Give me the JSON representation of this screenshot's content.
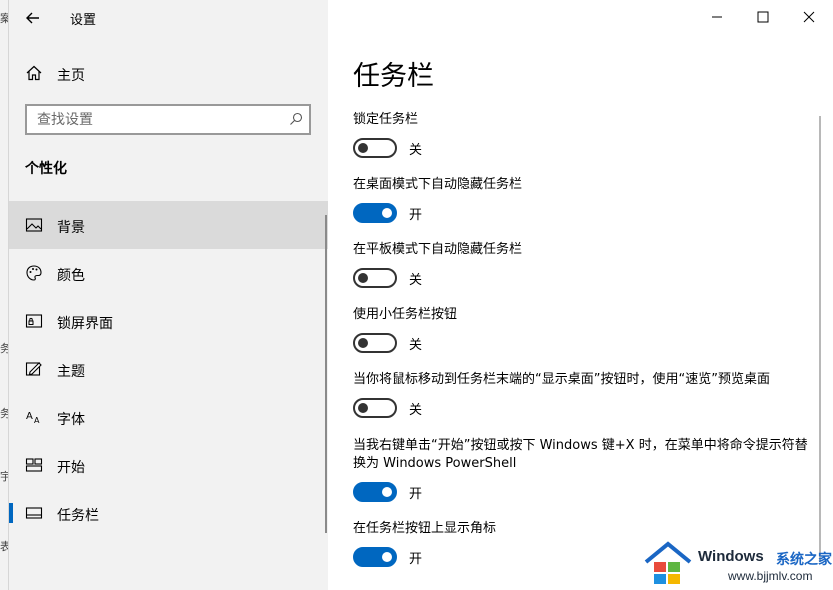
{
  "background_edge": {
    "fragments": [
      "案",
      "务",
      "务",
      "宇",
      "表"
    ]
  },
  "window": {
    "title": "设置"
  },
  "sidebar": {
    "home_label": "主页",
    "search_placeholder": "查找设置",
    "section_title": "个性化",
    "items": [
      {
        "label": "背景",
        "icon": "image-icon",
        "state": "hover"
      },
      {
        "label": "颜色",
        "icon": "palette-icon"
      },
      {
        "label": "锁屏界面",
        "icon": "lock-screen-icon"
      },
      {
        "label": "主题",
        "icon": "theme-icon"
      },
      {
        "label": "字体",
        "icon": "font-icon"
      },
      {
        "label": "开始",
        "icon": "start-icon"
      },
      {
        "label": "任务栏",
        "icon": "taskbar-icon",
        "state": "selected"
      }
    ]
  },
  "main": {
    "title": "任务栏",
    "settings": [
      {
        "desc": "锁定任务栏",
        "on": false,
        "state_label": "关"
      },
      {
        "desc": "在桌面模式下自动隐藏任务栏",
        "on": true,
        "state_label": "开"
      },
      {
        "desc": "在平板模式下自动隐藏任务栏",
        "on": false,
        "state_label": "关"
      },
      {
        "desc": "使用小任务栏按钮",
        "on": false,
        "state_label": "关"
      },
      {
        "desc": "当你将鼠标移动到任务栏末端的“显示桌面”按钮时，使用“速览”预览桌面",
        "on": false,
        "state_label": "关"
      },
      {
        "desc": "当我右键单击“开始”按钮或按下 Windows 键+X 时，在菜单中将命令提示符替换为 Windows PowerShell",
        "on": true,
        "state_label": "开"
      },
      {
        "desc": "在任务栏按钮上显示角标",
        "on": true,
        "state_label": "开"
      }
    ]
  },
  "watermark": {
    "brand": "Windows",
    "cn": "系统之家",
    "url": "www.bjjmlv.com"
  },
  "colors": {
    "accent": "#0067c0",
    "sidebar_bg": "#f2f2f2",
    "hover_bg": "#dadada"
  }
}
